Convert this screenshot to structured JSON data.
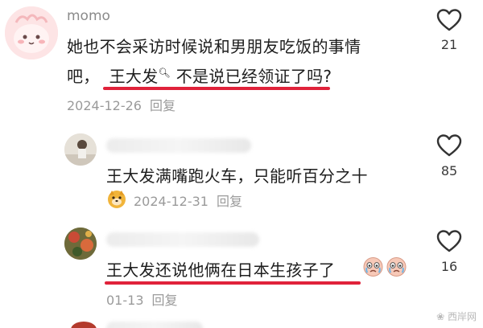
{
  "comments": [
    {
      "username": "momo",
      "line1": "她也不会采访时候说和男朋友吃饭的事情",
      "line2_prefix": "吧，",
      "line2_highlight": "王大发",
      "line2_suffix": " 不是说已经领证了吗?",
      "date": "2024-12-26",
      "reply_label": "回复",
      "likes": "21"
    },
    {
      "text": "王大发满嘴跑火车，只能听百分之十",
      "date": "2024-12-31",
      "reply_label": "回复",
      "likes": "85"
    },
    {
      "text": "王大发还说他俩在日本生孩子了",
      "date": "01-13",
      "reply_label": "回复",
      "likes": "16"
    }
  ],
  "watermark": "西岸网",
  "colors": {
    "underline": "#e0223a",
    "meta": "#9a9a9a"
  },
  "icons": [
    "heart-outline-icon",
    "search-magnifier-icon",
    "sticker-face-icon",
    "crying-face-emoji"
  ]
}
